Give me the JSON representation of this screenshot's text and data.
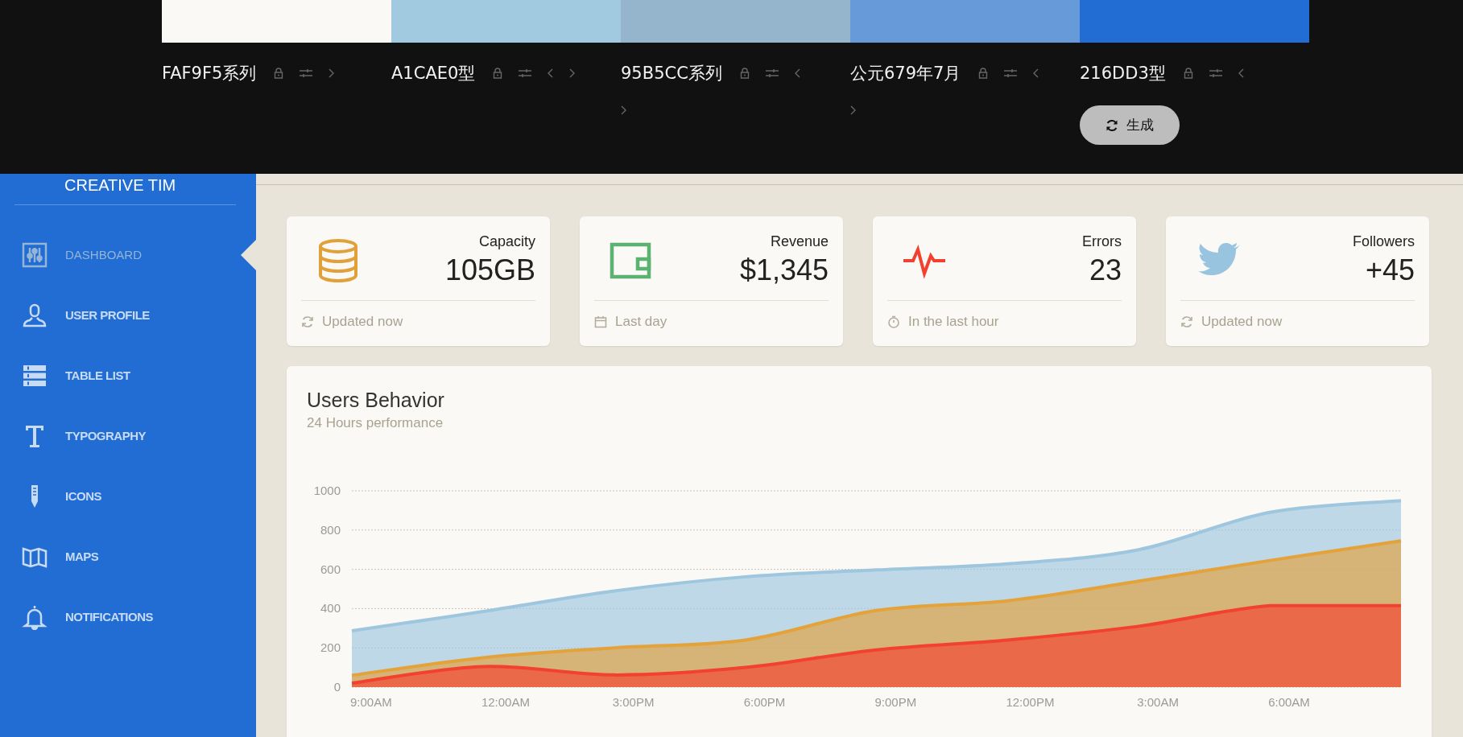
{
  "palette": {
    "swatches": [
      {
        "color": "#faf9f5",
        "label": "FAF9F5系列"
      },
      {
        "color": "#a1cae0",
        "label": "A1CAE0型"
      },
      {
        "color": "#95b5cc",
        "label": "95B5CC系列"
      },
      {
        "color": "#669ad8",
        "label": "公元679年7月"
      },
      {
        "color": "#216dd3",
        "label": "216DD3型"
      }
    ],
    "generate_button": "生成"
  },
  "sidebar": {
    "logo": "CREATIVE TIM",
    "items": [
      {
        "label": "DASHBOARD",
        "selected": true
      },
      {
        "label": "USER PROFILE",
        "selected": false
      },
      {
        "label": "TABLE LIST",
        "selected": false
      },
      {
        "label": "TYPOGRAPHY",
        "selected": false
      },
      {
        "label": "ICONS",
        "selected": false
      },
      {
        "label": "MAPS",
        "selected": false
      },
      {
        "label": "NOTIFICATIONS",
        "selected": false
      }
    ]
  },
  "stats": [
    {
      "title": "Capacity",
      "value": "105GB",
      "color": "#e1a13a",
      "footer": "Updated now"
    },
    {
      "title": "Revenue",
      "value": "$1,345",
      "color": "#5cb270",
      "footer": "Last day"
    },
    {
      "title": "Errors",
      "value": "23",
      "color": "#f2412f",
      "footer": "In the last hour"
    },
    {
      "title": "Followers",
      "value": "+45",
      "color": "#99c4e0",
      "footer": "Updated now"
    }
  ],
  "chart_card": {
    "title": "Users Behavior",
    "subtitle": "24 Hours performance",
    "chart_data": {
      "type": "area",
      "categories": [
        "9:00AM",
        "12:00AM",
        "3:00PM",
        "6:00PM",
        "9:00PM",
        "12:00PM",
        "3:00AM",
        "6:00AM",
        null
      ],
      "ylim": [
        0,
        1000
      ],
      "grid": true,
      "yticks": [
        0,
        200,
        400,
        600,
        800,
        1000
      ],
      "series": [
        {
          "color": "#9ec6de",
          "values": [
            287,
            385,
            490,
            562,
            597,
            628,
            700,
            890,
            950
          ]
        },
        {
          "color": "#e4a23b",
          "values": [
            60,
            150,
            200,
            240,
            390,
            440,
            540,
            645,
            745
          ]
        },
        {
          "color": "#f2412f",
          "values": [
            20,
            105,
            62,
            100,
            190,
            240,
            310,
            415,
            415
          ]
        }
      ]
    }
  }
}
